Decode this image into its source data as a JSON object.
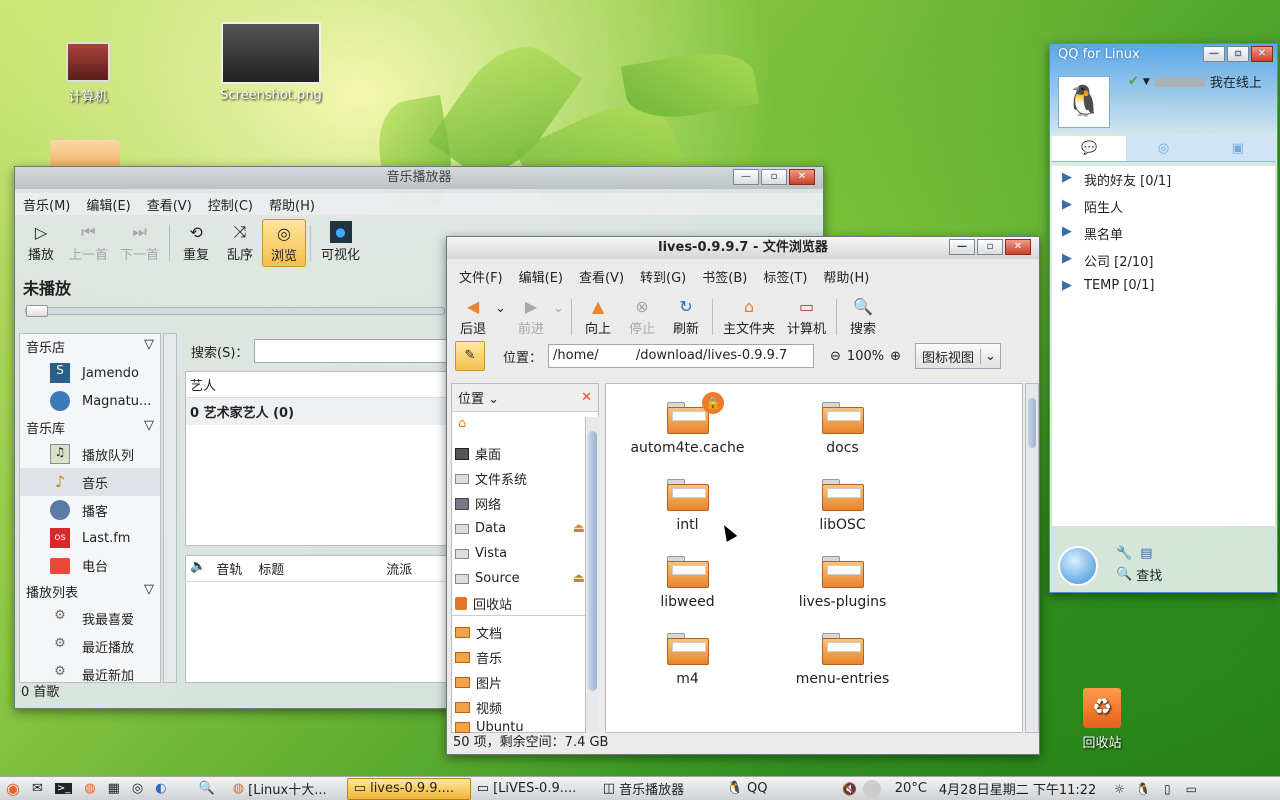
{
  "desktop": {
    "icons": [
      {
        "label": "计算机",
        "icon": "computer-icon"
      },
      {
        "label": "Screenshot.png",
        "icon": "image-file-icon"
      },
      {
        "label": "回收站",
        "icon": "trash-icon"
      }
    ]
  },
  "music": {
    "title": "音乐播放器",
    "menu": [
      "音乐(M)",
      "编辑(E)",
      "查看(V)",
      "控制(C)",
      "帮助(H)"
    ],
    "toolbar": {
      "play": "播放",
      "prev": "上一首",
      "next": "下一首",
      "repeat": "重复",
      "shuffle": "乱序",
      "browse": "浏览",
      "visual": "可视化"
    },
    "now_playing": "未播放",
    "sidebar": {
      "store_header": "音乐店",
      "jamendo": "Jamendo",
      "magnatune": "Magnatu...",
      "library_header": "音乐库",
      "queue": "播放队列",
      "music": "音乐",
      "podcast": "播客",
      "lastfm": "Last.fm",
      "radio": "电台",
      "playlists_header": "播放列表",
      "favorites": "我最喜爱",
      "recent": "最近播放",
      "recent_added": "最近新加"
    },
    "search_label": "搜索(S)：",
    "artist_header": "艺人",
    "artist_row": "0 艺术家艺人 (0)",
    "track_columns": [
      "音轨",
      "标题",
      "流派"
    ],
    "status": "0 首歌"
  },
  "files": {
    "title": "lives-0.9.9.7 - 文件浏览器",
    "menu": [
      "文件(F)",
      "编辑(E)",
      "查看(V)",
      "转到(G)",
      "书签(B)",
      "标签(T)",
      "帮助(H)"
    ],
    "toolbar": {
      "back": "后退",
      "forward": "前进",
      "up": "向上",
      "stop": "停止",
      "refresh": "刷新",
      "home": "主文件夹",
      "computer": "计算机",
      "search": "搜索"
    },
    "location_label": "位置：",
    "path": "/home/         /download/lives-0.9.9.7",
    "zoom": "100%",
    "view_mode": "图标视图",
    "side_header": "位置",
    "places": [
      {
        "label": "桌面",
        "icon": "desktop-icon"
      },
      {
        "label": "文件系统",
        "icon": "drive-icon"
      },
      {
        "label": "网络",
        "icon": "network-icon"
      },
      {
        "label": "Data",
        "icon": "drive-icon",
        "eject": true
      },
      {
        "label": "Vista",
        "icon": "drive-icon"
      },
      {
        "label": "Source",
        "icon": "drive-icon",
        "eject": true
      },
      {
        "label": "回收站",
        "icon": "trash-icon"
      },
      {
        "label": "文档",
        "icon": "folder-icon"
      },
      {
        "label": "音乐",
        "icon": "folder-icon"
      },
      {
        "label": "图片",
        "icon": "folder-icon"
      },
      {
        "label": "视频",
        "icon": "folder-icon"
      },
      {
        "label": "Ubuntu",
        "icon": "folder-icon"
      }
    ],
    "items": [
      "autom4te.cache",
      "docs",
      "intl",
      "libOSC",
      "libweed",
      "lives-plugins",
      "m4",
      "menu-entries"
    ],
    "status": "50 项，剩余空间：7.4 GB"
  },
  "qq": {
    "title": "QQ for Linux",
    "status": "我在线上",
    "groups": [
      "我的好友 [0/1]",
      "陌生人",
      "黑名单",
      "公司 [2/10]",
      "TEMP [0/1]"
    ],
    "find": "查找"
  },
  "taskbar": {
    "tasks": [
      "[Linux十大...",
      "lives-0.9.9....",
      "[LiVES-0.9....",
      "音乐播放器",
      "QQ"
    ],
    "weather": "20°C",
    "datetime": "4月28日星期二 下午11:22"
  },
  "colors": {
    "accent": "#f0b43a",
    "folder": "#e8842e",
    "qq_blue": "#3a8fd6"
  }
}
